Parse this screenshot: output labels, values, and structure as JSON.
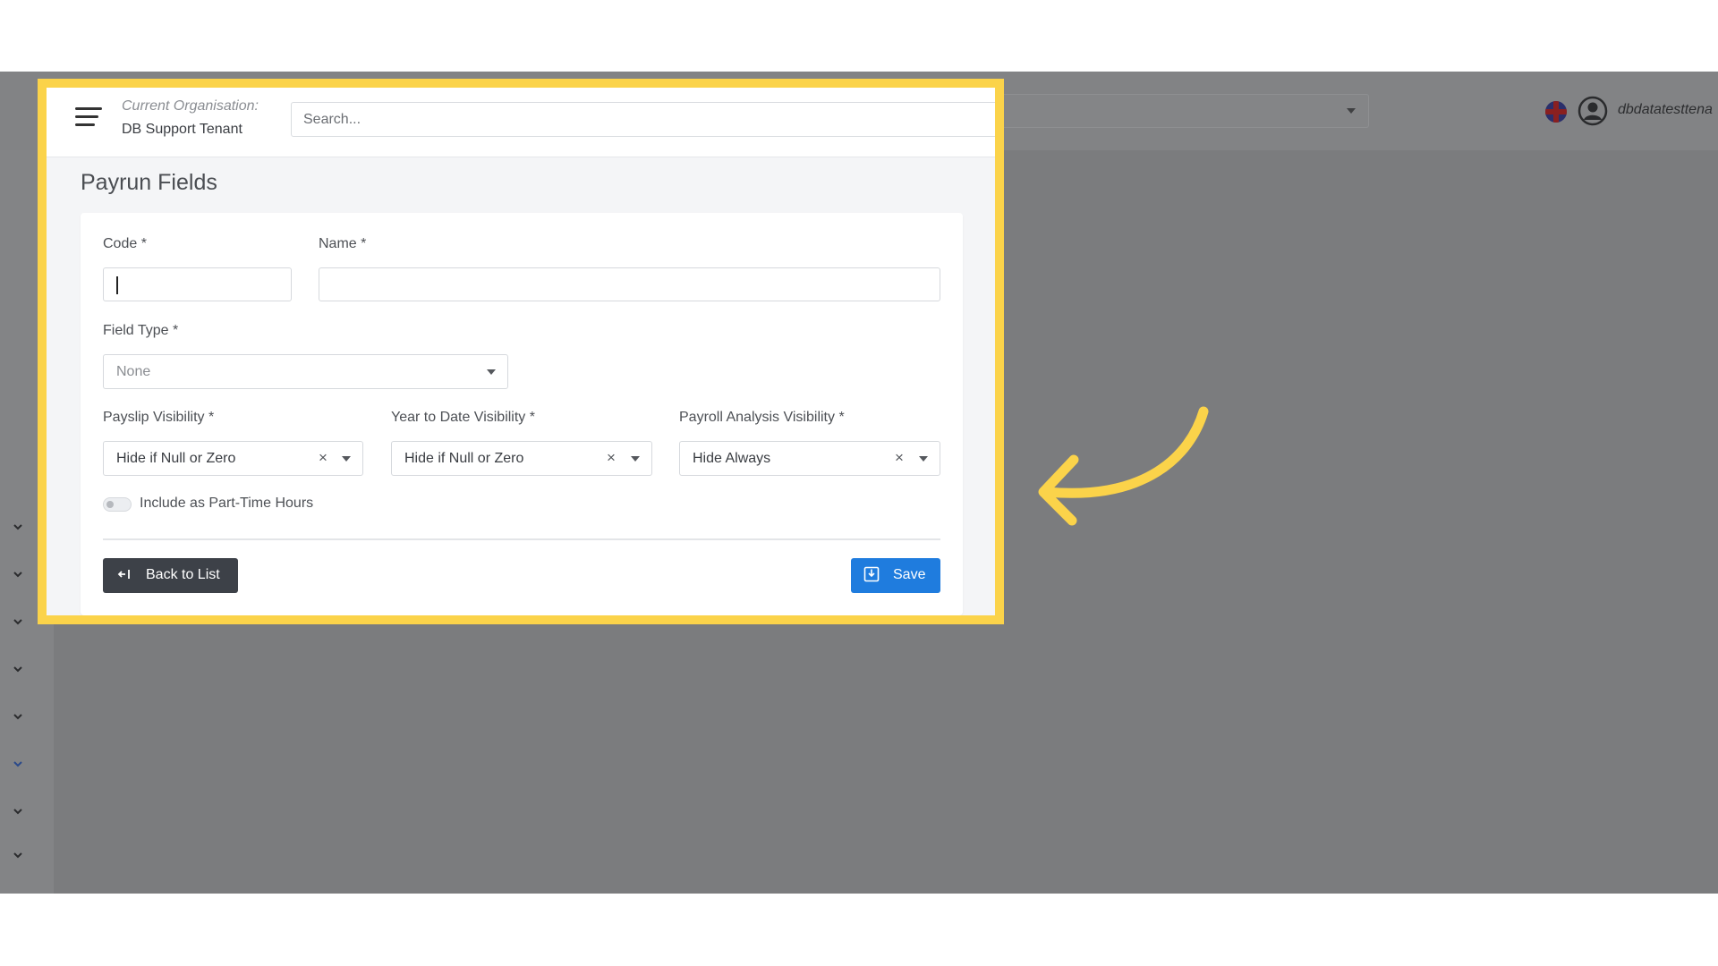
{
  "topbar": {
    "org_label": "Current Organisation:",
    "org_name": "DB Support Tenant",
    "search_placeholder": "Search...",
    "user_name": "dbdatatesttena"
  },
  "page": {
    "title": "Payrun Fields"
  },
  "form": {
    "code": {
      "label": "Code *",
      "value": ""
    },
    "name": {
      "label": "Name *",
      "value": ""
    },
    "field_type": {
      "label": "Field Type *",
      "value": "None"
    },
    "payslip_visibility": {
      "label": "Payslip Visibility *",
      "value": "Hide if Null or Zero"
    },
    "ytd_visibility": {
      "label": "Year to Date Visibility *",
      "value": "Hide if Null or Zero"
    },
    "analysis_visibility": {
      "label": "Payroll Analysis Visibility *",
      "value": "Hide Always"
    },
    "part_time_toggle": {
      "label": "Include as Part-Time Hours",
      "checked": false
    },
    "clear_glyph": "×"
  },
  "actions": {
    "back_label": "Back to List",
    "save_label": "Save"
  },
  "colors": {
    "highlight": "#fbd34a",
    "save": "#1f7cde",
    "back": "#3d4148",
    "overlay": "#7b7c7e"
  },
  "icons": [
    "menu-icon",
    "flag-uk-icon",
    "user-avatar-icon",
    "chevron-down-icon",
    "caret-down-icon",
    "back-arrow-icon",
    "save-icon",
    "annotation-arrow"
  ]
}
